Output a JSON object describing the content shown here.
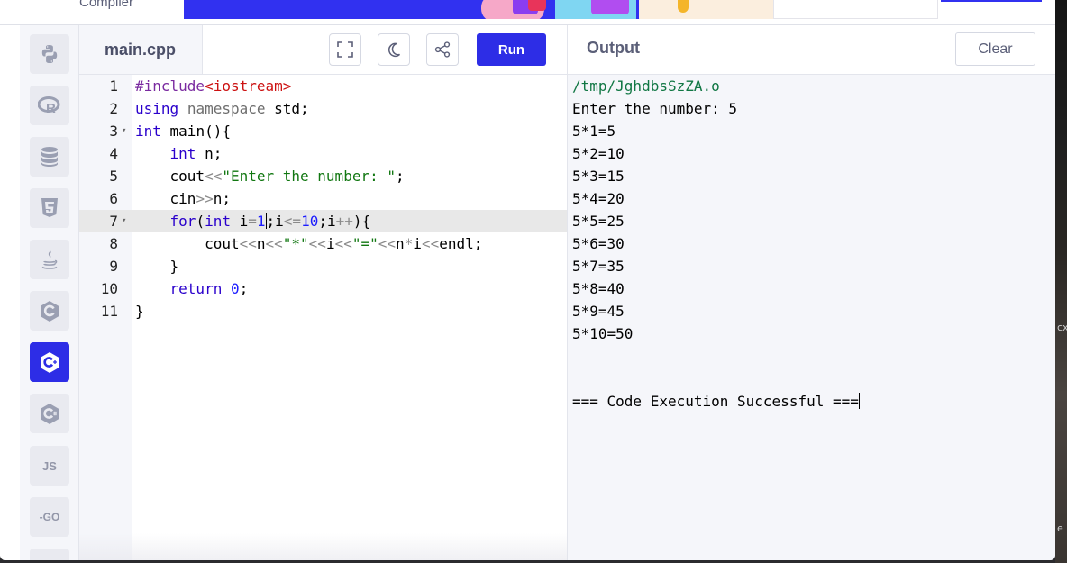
{
  "header": {
    "brand_subtitle": "Compiler"
  },
  "languages": [
    {
      "name": "python",
      "icon": "python-icon"
    },
    {
      "name": "r",
      "icon": "r-icon"
    },
    {
      "name": "sql",
      "icon": "database-icon"
    },
    {
      "name": "html",
      "icon": "html5-icon"
    },
    {
      "name": "java",
      "icon": "java-icon"
    },
    {
      "name": "c",
      "icon": "c-icon"
    },
    {
      "name": "cpp",
      "icon": "cpp-icon",
      "active": true
    },
    {
      "name": "csharp",
      "icon": "csharp-icon"
    },
    {
      "name": "javascript",
      "label": "JS"
    },
    {
      "name": "go",
      "label": "-GO"
    }
  ],
  "editor": {
    "filename": "main.cpp",
    "run_label": "Run",
    "current_line": 7
  },
  "output": {
    "title": "Output",
    "clear_label": "Clear",
    "lines": [
      "/tmp/JghdbsSzZA.o",
      "Enter the number: 5",
      "5*1=5",
      "5*2=10",
      "5*3=15",
      "5*4=20",
      "5*5=25",
      "5*6=30",
      "5*7=35",
      "5*8=40",
      "5*9=45",
      "5*10=50",
      "",
      "",
      "=== Code Execution Successful ==="
    ]
  },
  "colors": {
    "accent": "#2d2de6",
    "panel": "#f5f6fa"
  }
}
